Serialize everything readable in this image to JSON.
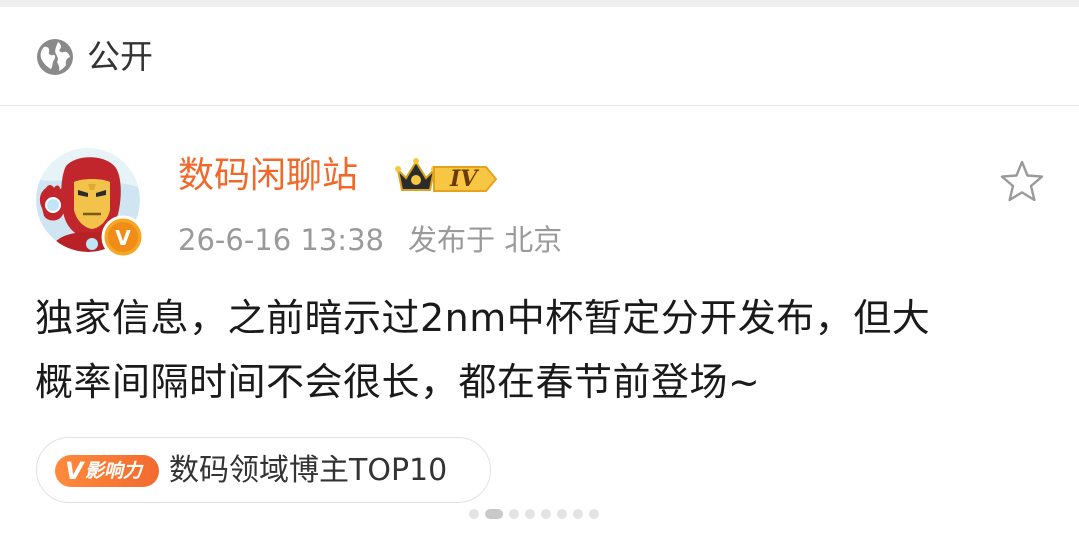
{
  "visibility": {
    "label": "公开",
    "icon": "globe-icon"
  },
  "author": {
    "name": "数码闲聊站",
    "level_badge": "IV",
    "crown_icon": "crown-icon",
    "verified_badge": "V",
    "avatar_icon": "ironman-avatar"
  },
  "post_meta": {
    "time": "26-6-16 13:38",
    "location_prefix": "发布于",
    "location": "北京"
  },
  "actions": {
    "favorite_icon": "star-icon"
  },
  "post": {
    "lines": [
      "独家信息，之前暗示过2nm中杯暂定分开发布，但大",
      "概率间隔时间不会很长，都在春节前登场~"
    ]
  },
  "influence": {
    "badge_v": "V",
    "badge_label": "影响力",
    "text": "数码领域博主TOP10"
  },
  "colors": {
    "username": "#f0692a",
    "accent_orange": "#f26a2e",
    "meta_gray": "#9a9a9a"
  }
}
